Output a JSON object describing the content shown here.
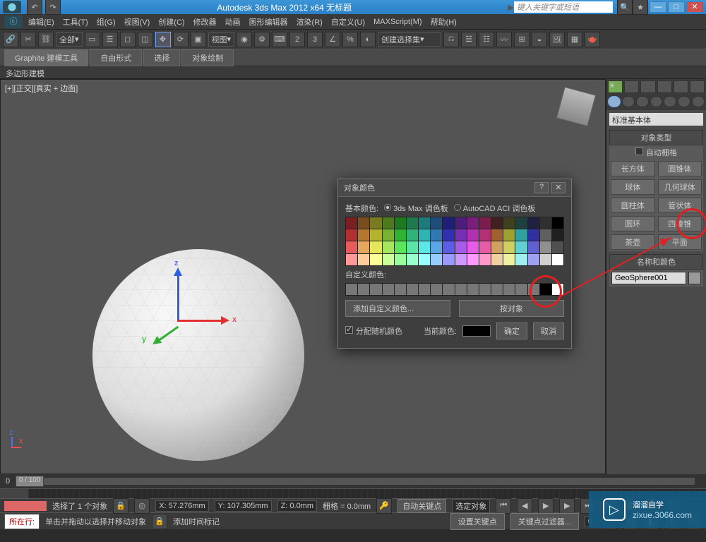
{
  "app": {
    "title": "Autodesk 3ds Max 2012 x64   无标题",
    "search_placeholder": "键入关键字或短语"
  },
  "menu": [
    "编辑(E)",
    "工具(T)",
    "组(G)",
    "视图(V)",
    "创建(C)",
    "修改器",
    "动画",
    "图形编辑器",
    "渲染(R)",
    "自定义(U)",
    "MAXScript(M)",
    "帮助(H)"
  ],
  "toolbar": {
    "scope": "全部",
    "view": "视图",
    "selset_drop": "创建选择集"
  },
  "ribbon": {
    "poly": "多边形建模",
    "tabs": [
      "Graphite 建模工具",
      "自由形式",
      "选择",
      "对象绘制"
    ]
  },
  "viewport": {
    "label": "[+][正交][真实 + 边面]",
    "axes": {
      "x": "x",
      "y": "y",
      "z": "z"
    }
  },
  "cornerax": {
    "x": "x",
    "z": "z"
  },
  "side": {
    "category_drop": "标准基本体",
    "rolls": {
      "types": "对象类型",
      "autogrid": "自动栅格",
      "name": "名称和颜色"
    },
    "prims": [
      [
        "长方体",
        "圆锥体"
      ],
      [
        "球体",
        "几何球体"
      ],
      [
        "圆柱体",
        "管状体"
      ],
      [
        "圆环",
        "四棱锥"
      ],
      [
        "茶壶",
        "平面"
      ]
    ],
    "objname": "GeoSphere001"
  },
  "dialog": {
    "title": "对象颜色",
    "basic": "基本颜色:",
    "pal1": "3ds Max 调色板",
    "pal2": "AutoCAD ACI 调色板",
    "custom": "自定义颜色:",
    "addcust": "添加自定义颜色...",
    "byobj": "按对象",
    "random": "分配随机颜色",
    "current": "当前颜色:",
    "ok": "确定",
    "cancel": "取消",
    "help": "?",
    "close": "✕"
  },
  "palette": [
    [
      "#7a1f1f",
      "#7a4d1f",
      "#7a7a1f",
      "#4d7a1f",
      "#1f7a1f",
      "#1f7a4d",
      "#1f7a7a",
      "#1f4d7a",
      "#1f1f7a",
      "#4d1f7a",
      "#7a1f7a",
      "#7a1f4d",
      "#402020",
      "#404020",
      "#204040",
      "#202040",
      "#303030",
      "#000000"
    ],
    [
      "#b33030",
      "#b37730",
      "#b3b330",
      "#77b330",
      "#30b330",
      "#30b377",
      "#30b3b3",
      "#3077b3",
      "#3030b3",
      "#7730b3",
      "#b330b3",
      "#b33077",
      "#a06030",
      "#a0a030",
      "#30a0a0",
      "#3030a0",
      "#606060",
      "#202020"
    ],
    [
      "#e65c5c",
      "#e6a65c",
      "#e6e65c",
      "#a6e65c",
      "#5ce65c",
      "#5ce6a6",
      "#5ce6e6",
      "#5ca6e6",
      "#5c5ce6",
      "#a65ce6",
      "#e65ce6",
      "#e65ca6",
      "#d0a060",
      "#d0d060",
      "#60d0d0",
      "#6060d0",
      "#909090",
      "#505050"
    ],
    [
      "#ff9999",
      "#ffcc99",
      "#ffff99",
      "#ccff99",
      "#99ff99",
      "#99ffcc",
      "#99ffff",
      "#99ccff",
      "#9999ff",
      "#cc99ff",
      "#ff99ff",
      "#ff99cc",
      "#f0d0a0",
      "#f0f0a0",
      "#a0f0f0",
      "#a0a0f0",
      "#d0d0d0",
      "#ffffff"
    ]
  ],
  "status": {
    "sel": "选择了 1 个对象",
    "hint": "单击并拖动以选择并移动对象",
    "x": "X: 57.276mm",
    "y": "Y: 107.305mm",
    "z": "Z: 0.0mm",
    "grid": "栅格 = 0.0mm",
    "autokey": "自动关键点",
    "selfilter": "选定对象",
    "setkey": "设置关键点",
    "keyfilter": "关键点过滤器...",
    "addtime": "添加时间标记",
    "frame": "0",
    "range": "0 / 100",
    "row": "所在行:"
  },
  "watermark": {
    "big": "溜溜自学",
    "small": "zixue.3066.com"
  }
}
